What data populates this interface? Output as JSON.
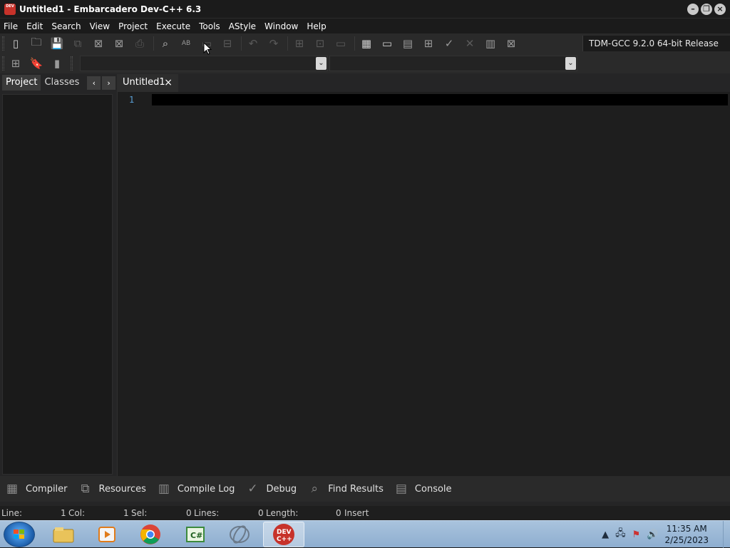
{
  "window": {
    "title": "Untitled1 - Embarcadero Dev-C++ 6.3",
    "app_icon_text": "DEV",
    "controls": [
      "minimize",
      "restore",
      "close"
    ]
  },
  "menu": [
    "File",
    "Edit",
    "Search",
    "View",
    "Project",
    "Execute",
    "Tools",
    "AStyle",
    "Window",
    "Help"
  ],
  "toolbar": {
    "compiler_selected": "TDM-GCC 9.2.0 64-bit Release",
    "icons_row1": [
      "new-file-icon",
      "open-icon",
      "save-icon",
      "save-all-icon",
      "close-icon",
      "close-all-icon",
      "print-icon",
      "find-icon",
      "replace-icon",
      "goto-icon",
      "indent-icon",
      "undo-icon",
      "redo-icon",
      "insert-icon",
      "toggle-bookmark-icon",
      "comment-icon",
      "compile-icon",
      "run-icon",
      "compile-run-icon",
      "rebuild-icon",
      "syntax-check-icon",
      "stop-icon",
      "chart-icon",
      "clean-icon"
    ],
    "icons_row2": [
      "new-class-icon",
      "bookmark-icon",
      "goto-bookmark-icon"
    ],
    "combo1_value": "",
    "combo2_value": ""
  },
  "left_panel": {
    "tabs": [
      "Project",
      "Classes"
    ],
    "active_tab": "Project",
    "prev_arrow": "‹",
    "next_arrow": "›"
  },
  "editor": {
    "tab_label": "Untitled1",
    "tab_close": "×",
    "line_numbers": [
      "1"
    ]
  },
  "bottom_tabs": [
    {
      "label": "Compiler",
      "icon": "grid-icon"
    },
    {
      "label": "Resources",
      "icon": "resources-icon"
    },
    {
      "label": "Compile Log",
      "icon": "chart-icon"
    },
    {
      "label": "Debug",
      "icon": "check-icon"
    },
    {
      "label": "Find Results",
      "icon": "find-icon"
    },
    {
      "label": "Console",
      "icon": "console-icon"
    }
  ],
  "status": {
    "line_label": "Line:",
    "line_value": "1",
    "col_label": "Col:",
    "col_value": "1",
    "sel_label": "Sel:",
    "sel_value": "0",
    "lines_label": "Lines:",
    "lines_value": "0",
    "length_label": "Length:",
    "length_value": "0",
    "mode": "Insert"
  },
  "taskbar": {
    "apps": [
      "file-explorer-icon",
      "media-player-icon",
      "chrome-icon",
      "csharp-icon",
      "eclipse-icon",
      "devcpp-icon"
    ],
    "active_app": "devcpp-icon",
    "devcpp_label_1": "DEV",
    "devcpp_label_2": "C++",
    "csharp_label": "C#",
    "clock_time": "11:35 AM",
    "clock_date": "2/25/2023"
  },
  "colors": {
    "titlebar": "#1b1b1b",
    "editor_bg": "#1e1e1e",
    "line_number": "#5aa0d6",
    "app_red": "#c7322a"
  }
}
